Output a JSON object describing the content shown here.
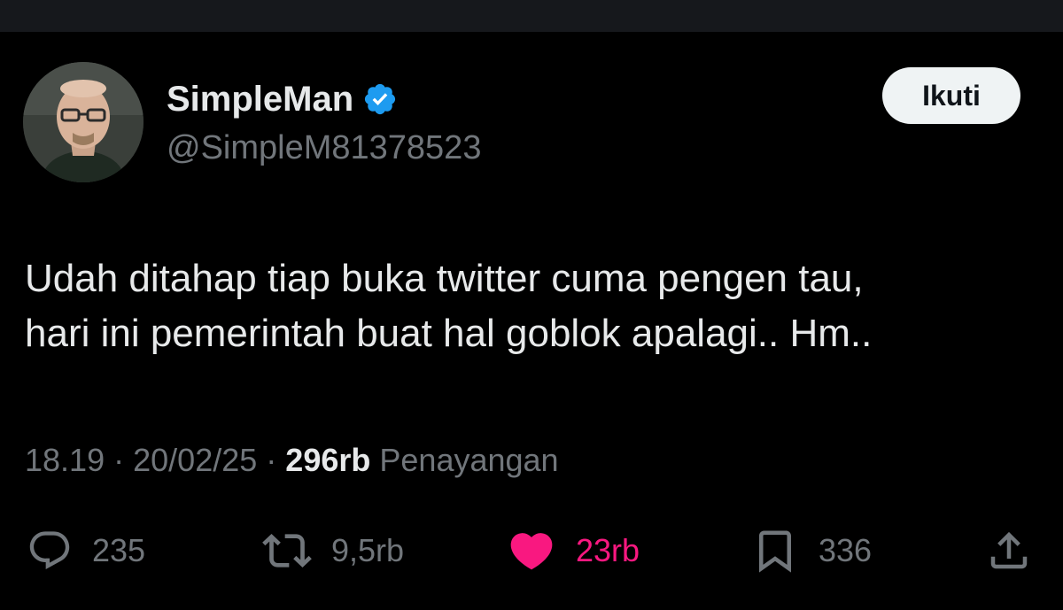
{
  "tweet": {
    "author": {
      "display_name": "SimpleMan",
      "handle": "@SimpleM81378523",
      "verified": true
    },
    "follow_label": "Ikuti",
    "text_lines": [
      "Udah ditahap tiap buka twitter cuma pengen tau,",
      "hari ini pemerintah buat hal goblok apalagi.. Hm.."
    ],
    "time": "18.19",
    "separator": "·",
    "date": "20/02/25",
    "views_count": "296rb",
    "views_label": "Penayangan"
  },
  "actions": {
    "replies": "235",
    "retweets": "9,5rb",
    "likes": "23rb",
    "bookmarks": "336"
  },
  "colors": {
    "background": "#000000",
    "text_primary": "#e7e9ea",
    "text_secondary": "#71767b",
    "verified_blue": "#1d9bf0",
    "like_pink": "#f91880",
    "follow_bg": "#eff3f4"
  },
  "icons": {
    "reply": "reply-icon",
    "retweet": "retweet-icon",
    "like": "heart-icon",
    "bookmark": "bookmark-icon",
    "share": "share-icon",
    "verified": "verified-badge-icon"
  }
}
